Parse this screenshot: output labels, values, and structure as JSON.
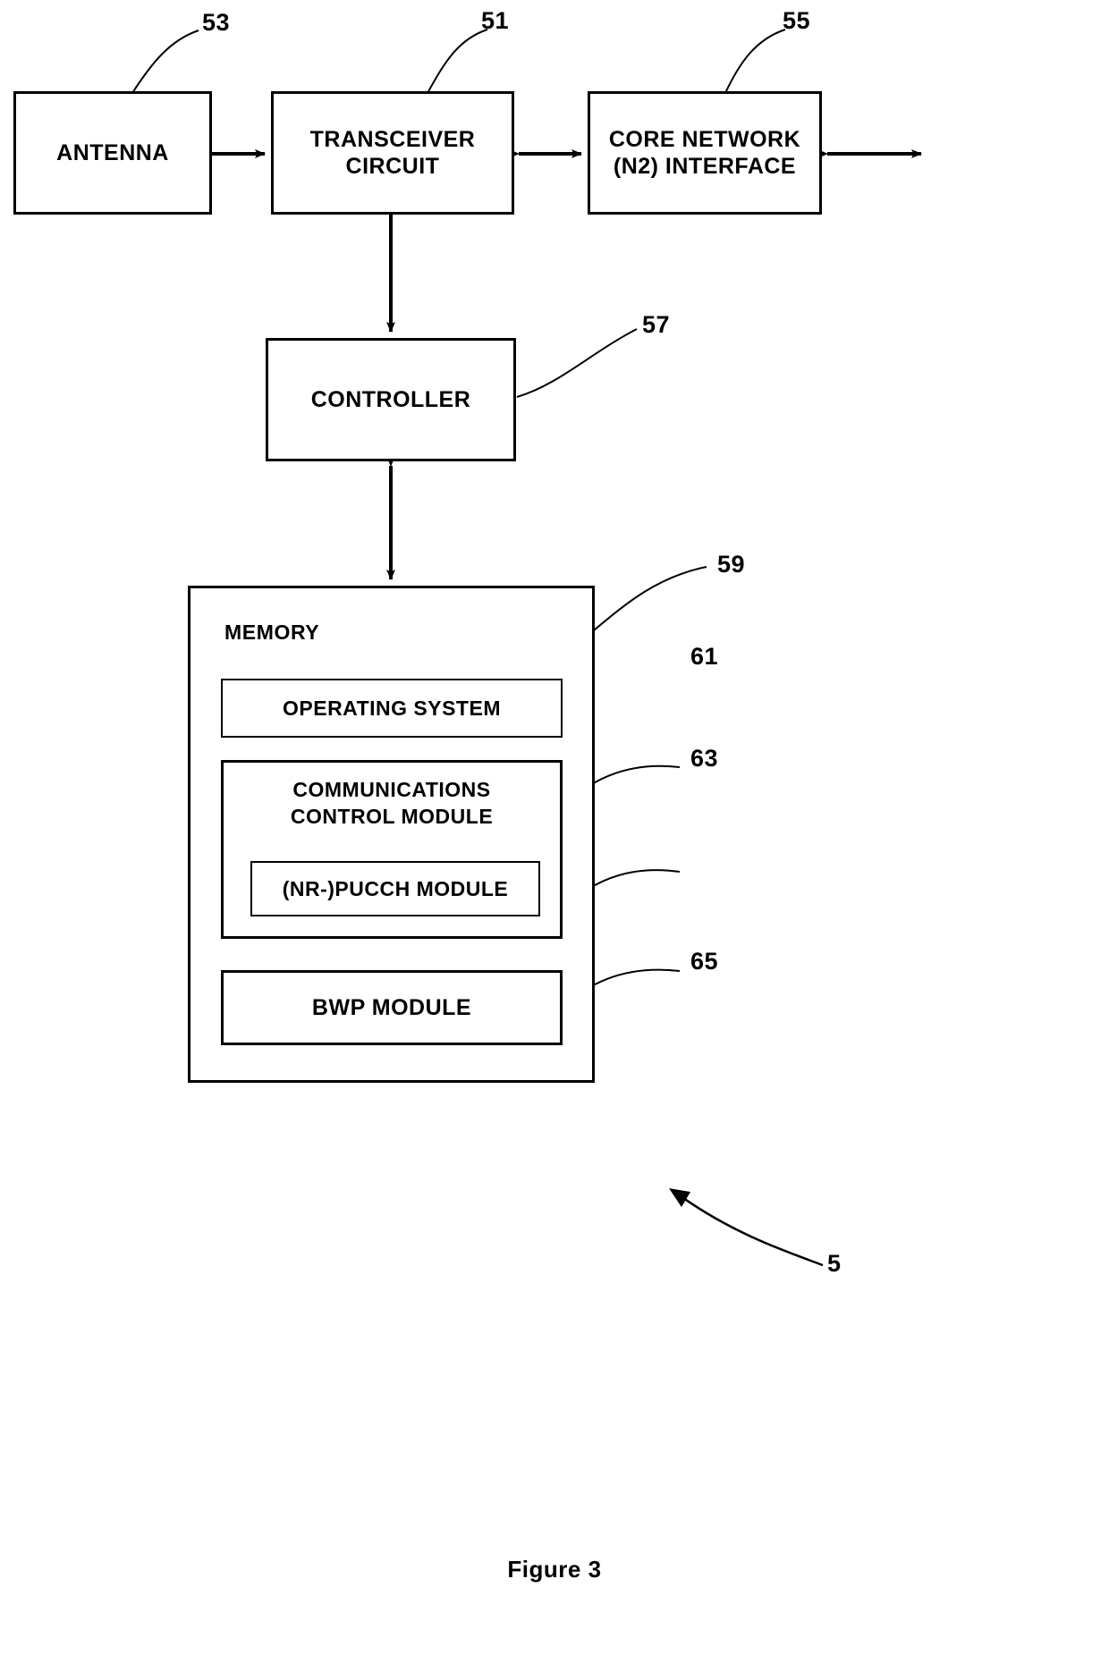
{
  "figure": {
    "caption": "Figure 3",
    "overall_ref": "5"
  },
  "blocks": {
    "antenna": {
      "label": "ANTENNA",
      "ref": "53"
    },
    "transceiver": {
      "line1": "TRANSCEIVER",
      "line2": "CIRCUIT",
      "ref": "51"
    },
    "core_network": {
      "line1": "CORE NETWORK",
      "line2": "(N2) INTERFACE",
      "ref": "55"
    },
    "controller": {
      "label": "CONTROLLER",
      "ref": "57"
    },
    "memory": {
      "title": "MEMORY",
      "ref": "59",
      "modules": [
        {
          "label": "OPERATING SYSTEM",
          "ref": "61"
        },
        {
          "line1": "COMMUNICATIONS",
          "line2": "CONTROL MODULE",
          "ref": "63"
        },
        {
          "label": "(NR-)PUCCH MODULE",
          "ref": ""
        },
        {
          "label": "BWP MODULE",
          "ref": "65"
        }
      ]
    }
  },
  "connectors": [
    {
      "name": "antenna-transceiver",
      "type": "double-arrow-horizontal"
    },
    {
      "name": "transceiver-core-network",
      "type": "double-arrow-horizontal"
    },
    {
      "name": "core-network-external",
      "type": "double-arrow-horizontal"
    },
    {
      "name": "transceiver-controller",
      "type": "double-arrow-vertical"
    },
    {
      "name": "controller-memory",
      "type": "double-arrow-vertical"
    }
  ],
  "colors": {
    "line": "#000000",
    "background": "#ffffff"
  }
}
